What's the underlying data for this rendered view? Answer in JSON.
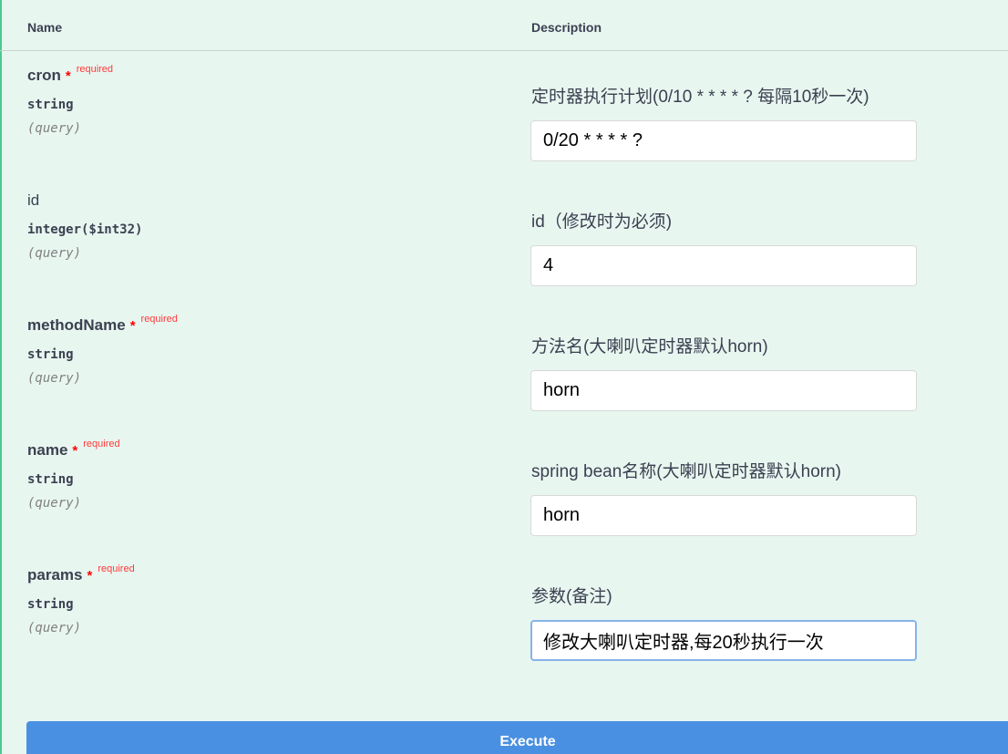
{
  "table": {
    "headers": {
      "name": "Name",
      "description": "Description"
    }
  },
  "params": [
    {
      "name": "cron",
      "required": true,
      "required_star": "*",
      "required_label": "required",
      "type": "string",
      "in": "(query)",
      "description": "定时器执行计划(0/10 * * * * ? 每隔10秒一次)",
      "value": "0/20 * * * * ?"
    },
    {
      "name": "id",
      "required": false,
      "type": "integer($int32)",
      "in": "(query)",
      "description": "id（修改时为必须)",
      "value": "4"
    },
    {
      "name": "methodName",
      "required": true,
      "required_star": "*",
      "required_label": "required",
      "type": "string",
      "in": "(query)",
      "description": "方法名(大喇叭定时器默认horn)",
      "value": "horn"
    },
    {
      "name": "name",
      "required": true,
      "required_star": "*",
      "required_label": "required",
      "type": "string",
      "in": "(query)",
      "description": "spring bean名称(大喇叭定时器默认horn)",
      "value": "horn"
    },
    {
      "name": "params",
      "required": true,
      "required_star": "*",
      "required_label": "required",
      "type": "string",
      "in": "(query)",
      "description": "参数(备注)",
      "value": "修改大喇叭定时器,每20秒执行一次"
    }
  ],
  "execute": {
    "label": "Execute"
  },
  "colors": {
    "background": "#e8f6f0",
    "accent_border": "#49cc90",
    "required": "#ff0000",
    "execute_button": "#4990e2"
  }
}
